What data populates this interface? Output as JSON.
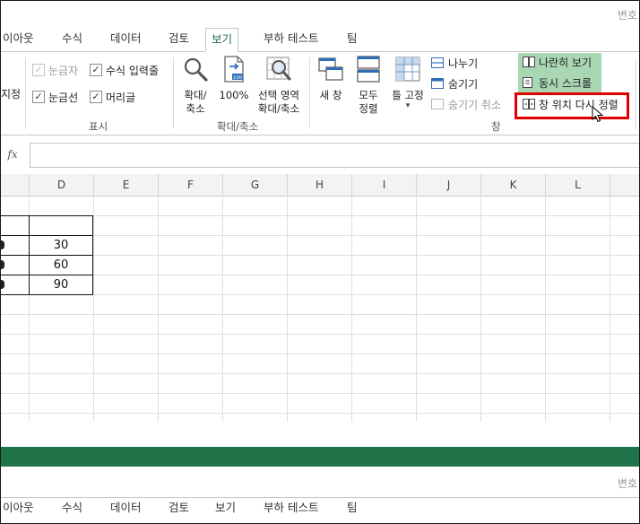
{
  "window": {
    "title_fragment": "변호"
  },
  "tabs": [
    {
      "label": "이아웃"
    },
    {
      "label": "수식"
    },
    {
      "label": "데이터"
    },
    {
      "label": "검토"
    },
    {
      "label": "보기"
    },
    {
      "label": "부하 테스트"
    },
    {
      "label": "팀"
    }
  ],
  "ribbon": {
    "show_group": {
      "partial_label": "지정",
      "ruler": "눈금자",
      "formula_bar": "수식 입력줄",
      "gridlines": "눈금선",
      "headings": "머리글",
      "group_label": "표시"
    },
    "zoom_group": {
      "zoom": "확대/\n축소",
      "zoom_100": "100%",
      "zoom_selection": "선택 영역\n확대/축소",
      "group_label": "확대/축소",
      "icon_text_100": "100"
    },
    "window_group": {
      "new_window": "새 창",
      "arrange_all": "모두\n정렬",
      "freeze_panes": "틀 고정",
      "freeze_arrow": "▾",
      "split": "나누기",
      "hide": "숨기기",
      "unhide": "숨기기 취소",
      "view_side_by_side": "나란히 보기",
      "synchronous_scrolling": "동시 스크롤",
      "reset_window_position": "창 위치 다시 정렬",
      "group_label": "창"
    }
  },
  "formula_bar": {
    "fx": "fx",
    "value": ""
  },
  "grid": {
    "columns": [
      "D",
      "E",
      "F",
      "G",
      "H",
      "I",
      "J",
      "K",
      "L"
    ],
    "values": [
      "30",
      "60",
      "90"
    ]
  },
  "lower_tabs": [
    {
      "label": "이아웃"
    },
    {
      "label": "수식"
    },
    {
      "label": "데이터"
    },
    {
      "label": "검토"
    },
    {
      "label": "보기"
    },
    {
      "label": "부하 테스트"
    },
    {
      "label": "팀"
    }
  ],
  "lower_window": {
    "title_fragment": "변호"
  },
  "colors": {
    "accent_green": "#21734a",
    "highlight_green": "#a9d7b4",
    "callout_red": "#e00000"
  }
}
